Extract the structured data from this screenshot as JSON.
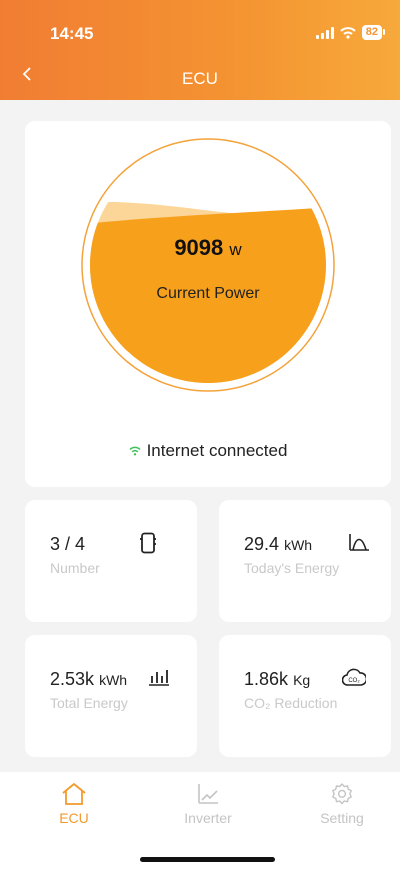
{
  "status_bar": {
    "time": "14:45",
    "battery": "82"
  },
  "nav": {
    "back_icon": "chevron-left-icon",
    "title": "ECU"
  },
  "power": {
    "value": "9098",
    "unit": "w",
    "label": "Current Power",
    "fill_fraction": 0.73,
    "color_fill": "#f7a01c",
    "color_light": "#fcd698"
  },
  "connection": {
    "text": "Internet connected",
    "color": "#3bc15a"
  },
  "stats": {
    "number": {
      "value": "3 / 4",
      "unit": "",
      "label": "Number",
      "icon": "device-icon"
    },
    "today_energy": {
      "value": "29.4",
      "unit": "kWh",
      "label": "Today's Energy",
      "icon": "curve-icon"
    },
    "total_energy": {
      "value": "2.53k",
      "unit": "kWh",
      "label": "Total Energy",
      "icon": "bar-chart-icon"
    },
    "co2": {
      "value": "1.86k",
      "unit": "Kg",
      "label": "CO₂ Reduction",
      "icon": "co2-cloud-icon"
    }
  },
  "tabs": [
    {
      "label": "ECU",
      "icon": "home-icon",
      "active": true
    },
    {
      "label": "Inverter",
      "icon": "line-chart-icon",
      "active": false
    },
    {
      "label": "Setting",
      "icon": "gear-icon",
      "active": false
    }
  ],
  "accent": "#f39a2d"
}
